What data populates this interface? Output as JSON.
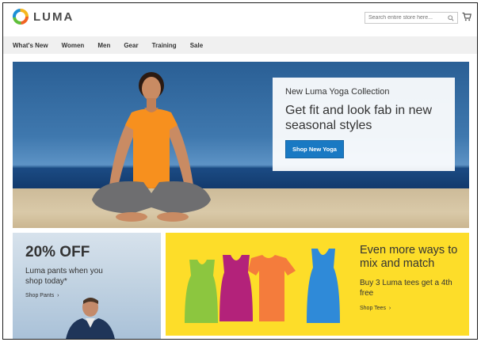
{
  "header": {
    "logo_text": "LUMA",
    "search_placeholder": "Search entire store here...",
    "icons": {
      "search": "search-icon",
      "cart": "cart-icon",
      "logo": "luma-logo-icon"
    }
  },
  "nav": {
    "items": [
      "What's New",
      "Women",
      "Men",
      "Gear",
      "Training",
      "Sale"
    ]
  },
  "hero": {
    "subtitle": "New Luma Yoga Collection",
    "title": "Get fit and look fab in new seasonal styles",
    "button": "Shop New Yoga"
  },
  "block_pants": {
    "headline": "20% OFF",
    "text": "Luma pants when you shop today*",
    "link": "Shop Pants"
  },
  "block_tees": {
    "headline": "Even more ways to mix and match",
    "text": "Buy 3 Luma tees get a 4th free",
    "link": "Shop Tees"
  },
  "colors": {
    "accent_button": "#1979c3",
    "tees_background": "#fddd29",
    "nav_background": "#f0f0f0"
  }
}
